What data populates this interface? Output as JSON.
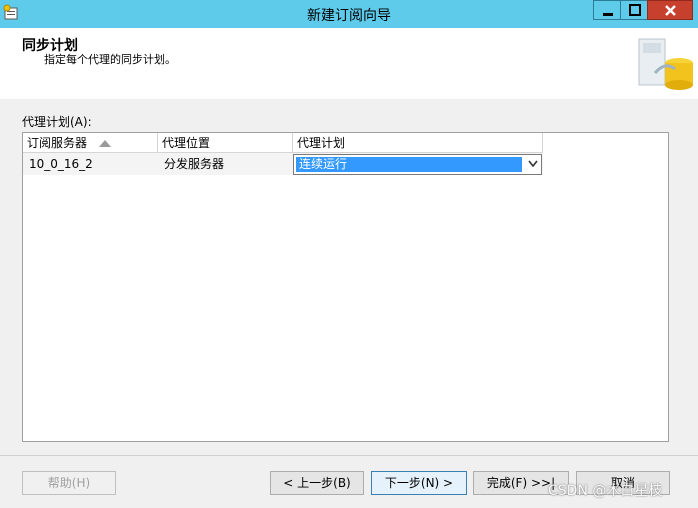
{
  "window": {
    "title": "新建订阅向导"
  },
  "header": {
    "title": "同步计划",
    "subtitle": "指定每个代理的同步计划。"
  },
  "list_label": "代理计划(A):",
  "grid": {
    "columns": [
      "订阅服务器",
      "代理位置",
      "代理计划"
    ],
    "sort_column": "订阅服务器",
    "rows": [
      {
        "subscriber": "10_0_16_2",
        "location": "分发服务器",
        "schedule": "连续运行"
      }
    ]
  },
  "buttons": {
    "help": "帮助(H)",
    "back": "< 上一步(B)",
    "next": "下一步(N) >",
    "finish": "完成(F) >>|",
    "cancel": "取消"
  },
  "watermark": "CSDN @木白星枝",
  "colors": {
    "titlebar": "#5ecbeb",
    "close_button": "#c7402d",
    "selection": "#3399ff"
  }
}
